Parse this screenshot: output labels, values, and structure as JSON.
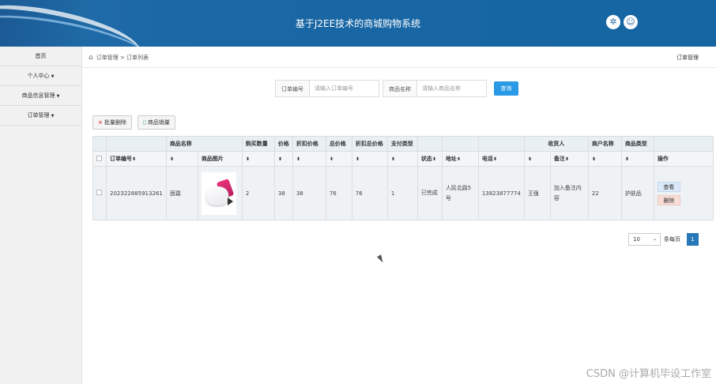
{
  "header": {
    "title": "基于J2EE技术的商城购物系统",
    "icons": [
      "settings-icon",
      "user-icon"
    ],
    "colors": {
      "bar": "#1565a3"
    }
  },
  "sidebar": {
    "items": [
      {
        "label": "首页",
        "dropdown": false
      },
      {
        "label": "个人中心",
        "dropdown": true
      },
      {
        "label": "商品信息管理",
        "dropdown": true
      },
      {
        "label": "订单管理",
        "dropdown": true
      }
    ]
  },
  "breadcrumb": {
    "path": "订单管理 > 订单列表",
    "right": "订单管理"
  },
  "search": {
    "order_label": "订单编号",
    "order_placeholder": "请输入订单编号",
    "product_label": "商品名称",
    "product_placeholder": "请输入商品名称",
    "button": "查询"
  },
  "toolbar": {
    "batch_delete": "批量删除",
    "sales": "商品销量"
  },
  "table": {
    "group_headers": [
      "商品名称",
      "购买数量",
      "价格",
      "折扣价格",
      "总价格",
      "折扣总价格",
      "支付类型",
      "收货人",
      "商户名称",
      "商品类型"
    ],
    "headers": [
      "订单编号",
      "商品图片",
      "状态",
      "地址",
      "电话",
      "备注",
      "操作"
    ],
    "rows": [
      {
        "order_no": "202322885913261",
        "product_name": "面霜",
        "quantity": "2",
        "price": "38",
        "discount_price": "38",
        "total_price": "76",
        "discount_total": "76",
        "pay_type": "1",
        "status": "已完成",
        "address": "人民北路5号",
        "phone": "13823877774",
        "receiver": "王强",
        "remark": "加入备注内容",
        "merchant": "22",
        "category": "护肤品",
        "view": "查看",
        "delete": "删除"
      }
    ]
  },
  "pagination": {
    "page_size": "10",
    "per_page_label": "条每页",
    "current_page": "1"
  },
  "watermark": "CSDN @计算机毕设工作室"
}
